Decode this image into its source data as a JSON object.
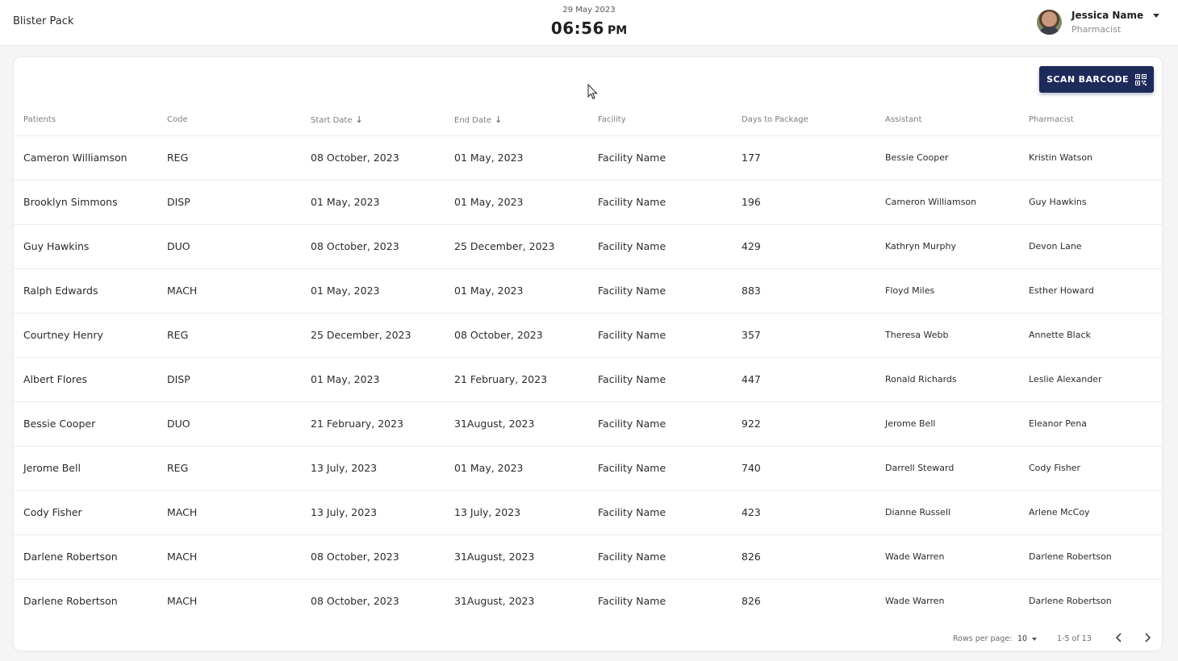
{
  "header": {
    "app_title": "Blister Pack",
    "date": "29 May 2023",
    "time": "06:56",
    "ampm": "PM",
    "user_name": "Jessica Name",
    "user_role": "Pharmacist",
    "avatar_icon": "avatar-photo",
    "menu_icon": "caret-down-icon"
  },
  "toolbar": {
    "scan_label": "SCAN BARCODE",
    "scan_icon": "qr-code-icon",
    "scan_color": "#1e2a5a"
  },
  "table": {
    "columns": [
      "Patients",
      "Code",
      "Start Date",
      "End Date",
      "Facility",
      "Days to Package",
      "Assistant",
      "Pharmacist"
    ],
    "sorted_columns": [
      "Start Date",
      "End Date"
    ],
    "rows": [
      [
        "Cameron Williamson",
        "REG",
        "08 October, 2023",
        "01 May, 2023",
        "Facility Name",
        "177",
        "Bessie Cooper",
        "Kristin Watson"
      ],
      [
        "Brooklyn Simmons",
        "DISP",
        "01 May, 2023",
        "01 May, 2023",
        "Facility Name",
        "196",
        "Cameron Williamson",
        "Guy Hawkins"
      ],
      [
        "Guy Hawkins",
        "DUO",
        "08 October, 2023",
        "25 December, 2023",
        "Facility Name",
        "429",
        "Kathryn Murphy",
        "Devon Lane"
      ],
      [
        "Ralph Edwards",
        "MACH",
        "01 May, 2023",
        "01 May, 2023",
        "Facility Name",
        "883",
        "Floyd Miles",
        "Esther Howard"
      ],
      [
        "Courtney Henry",
        "REG",
        "25 December, 2023",
        "08 October, 2023",
        "Facility Name",
        "357",
        "Theresa Webb",
        "Annette Black"
      ],
      [
        "Albert Flores",
        "DISP",
        "01 May, 2023",
        "21 February, 2023",
        "Facility Name",
        "447",
        "Ronald Richards",
        "Leslie Alexander"
      ],
      [
        "Bessie Cooper",
        "DUO",
        "21 February, 2023",
        "31August, 2023",
        "Facility Name",
        "922",
        "Jerome Bell",
        "Eleanor Pena"
      ],
      [
        "Jerome Bell",
        "REG",
        "13 July, 2023",
        "01 May, 2023",
        "Facility Name",
        "740",
        "Darrell Steward",
        "Cody Fisher"
      ],
      [
        "Cody Fisher",
        "MACH",
        "13 July, 2023",
        "13 July, 2023",
        "Facility Name",
        "423",
        "Dianne Russell",
        "Arlene McCoy"
      ],
      [
        "Darlene Robertson",
        "MACH",
        "08 October, 2023",
        "31August, 2023",
        "Facility Name",
        "826",
        "Wade Warren",
        "Darlene Robertson"
      ],
      [
        "Darlene Robertson",
        "MACH",
        "08 October, 2023",
        "31August, 2023",
        "Facility Name",
        "826",
        "Wade Warren",
        "Darlene Robertson"
      ]
    ]
  },
  "pagination": {
    "rows_per_page_label": "Rows per page:",
    "rows_per_page_value": "10",
    "range_label": "1-5 of 13",
    "prev_icon": "chevron-left-icon",
    "next_icon": "chevron-right-icon"
  }
}
